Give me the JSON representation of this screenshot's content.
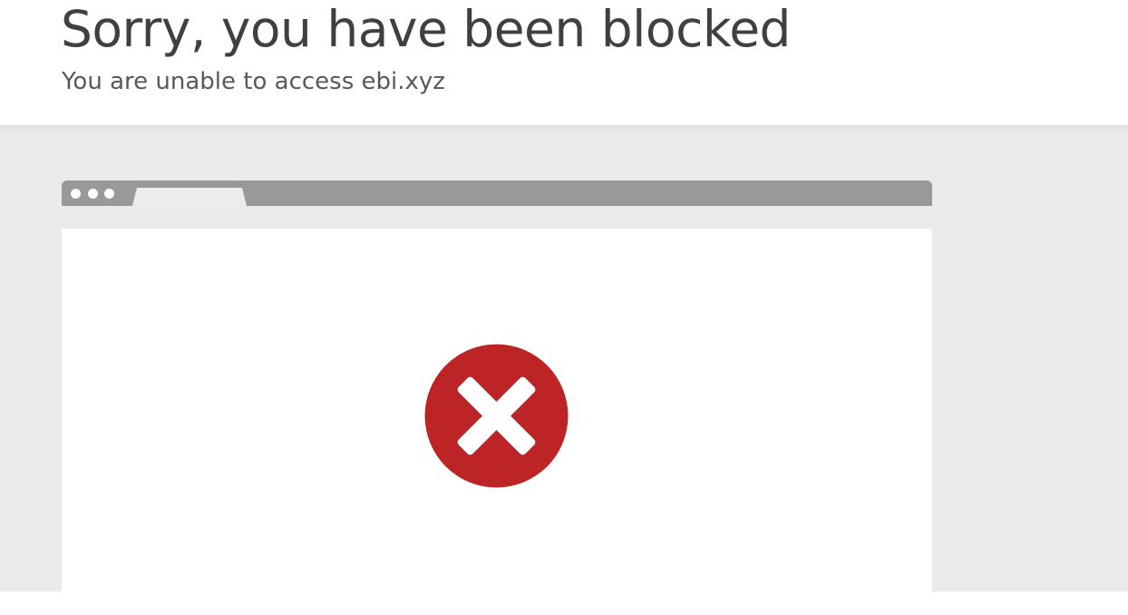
{
  "page": {
    "title": "Sorry, you have been blocked",
    "subtitle": "You are unable to access ebi.xyz"
  },
  "icons": {
    "browser_dots": [
      "dot-icon",
      "dot-icon",
      "dot-icon"
    ],
    "status": "error-x-icon"
  },
  "colors": {
    "title_text": "#404040",
    "subtitle_text": "#595959",
    "band_background": "#eaeaea",
    "browser_bar": "#999999",
    "error_red": "#bd2426"
  }
}
